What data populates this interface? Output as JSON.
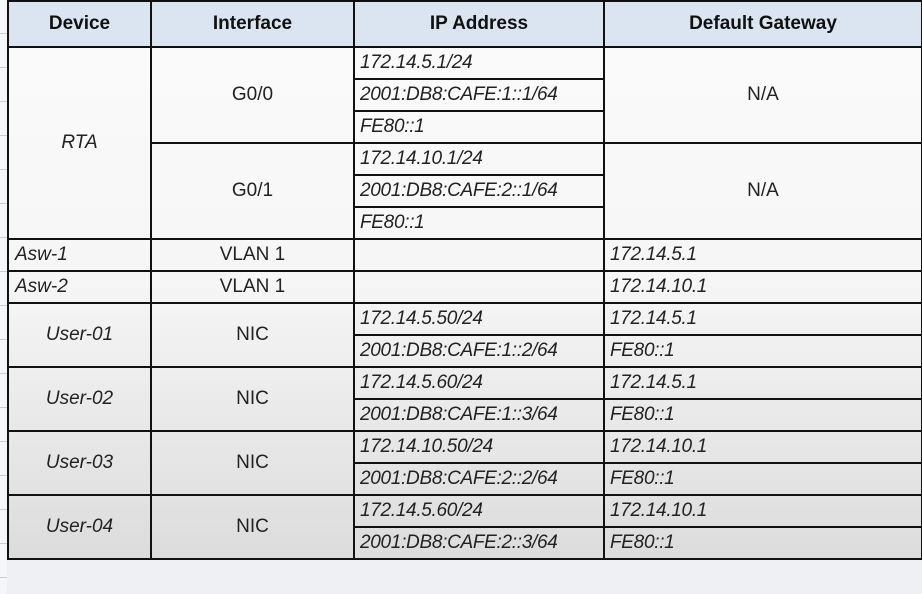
{
  "headers": [
    "Device",
    "Interface",
    "IP Address",
    "Default Gateway"
  ],
  "rta": {
    "device": "RTA",
    "interfaces": [
      {
        "name": "G0/0",
        "ips": [
          "172.14.5.1/24",
          "2001:DB8:CAFE:1::1/64",
          "FE80::1"
        ],
        "gateway": "N/A"
      },
      {
        "name": "G0/1",
        "ips": [
          "172.14.10.1/24",
          "2001:DB8:CAFE:2::1/64",
          "FE80::1"
        ],
        "gateway": "N/A"
      }
    ]
  },
  "switches": [
    {
      "device": "Asw-1",
      "interface": "VLAN 1",
      "ip": "",
      "gateway": "172.14.5.1"
    },
    {
      "device": "Asw-2",
      "interface": "VLAN 1",
      "ip": "",
      "gateway": "172.14.10.1"
    }
  ],
  "users": [
    {
      "device": "User-01",
      "interface": "NIC",
      "ips": [
        "172.14.5.50/24",
        "2001:DB8:CAFE:1::2/64"
      ],
      "gateways": [
        "172.14.5.1",
        "FE80::1"
      ]
    },
    {
      "device": "User-02",
      "interface": "NIC",
      "ips": [
        "172.14.5.60/24",
        "2001:DB8:CAFE:1::3/64"
      ],
      "gateways": [
        "172.14.5.1",
        "FE80::1"
      ]
    },
    {
      "device": "User-03",
      "interface": "NIC",
      "ips": [
        "172.14.10.50/24",
        "2001:DB8:CAFE:2::2/64"
      ],
      "gateways": [
        "172.14.10.1",
        "FE80::1"
      ]
    },
    {
      "device": "User-04",
      "interface": "NIC",
      "ips": [
        "172.14.5.60/24",
        "2001:DB8:CAFE:2::3/64"
      ],
      "gateways": [
        "172.14.10.1",
        "FE80::1"
      ]
    }
  ]
}
